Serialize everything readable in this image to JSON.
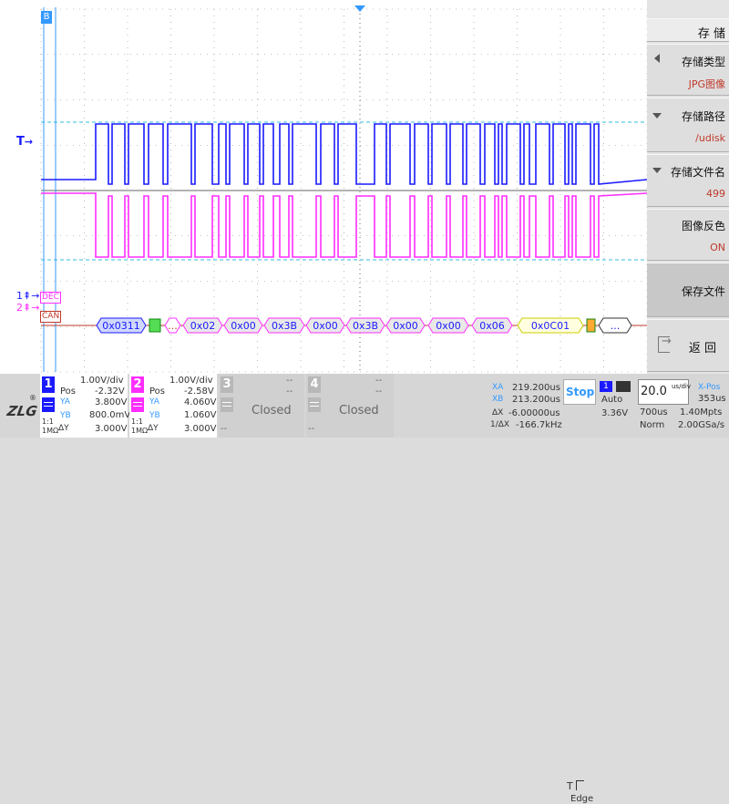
{
  "scope": {
    "trigger_marker": "T",
    "ch1_marker": "1",
    "ch2_marker": "2",
    "dec_label": "DEC",
    "can_label": "CAN",
    "cursor_label": "B",
    "bus_frames": [
      "0x0311",
      "...",
      "0x02",
      "0x00",
      "0x3B",
      "0x00",
      "0x3B",
      "0x00",
      "0x00",
      "0x06",
      "0x0C01",
      "..."
    ],
    "colors": {
      "ch1": "#1a1aff",
      "ch2": "#ff2dff",
      "grid": "#8a8a8a",
      "cursor": "#3399ff",
      "trigger_level": "#33bbdd"
    }
  },
  "menu": {
    "title": "存 储",
    "items": [
      {
        "label": "存储类型",
        "value": "JPG图像",
        "icon": "chevron-left-icon"
      },
      {
        "label": "存储路径",
        "value": "/udisk",
        "icon": "triangle-down-icon"
      },
      {
        "label": "存储文件名",
        "value": "499",
        "icon": "triangle-down-icon"
      },
      {
        "label": "图像反色",
        "value": "ON",
        "icon": ""
      },
      {
        "label": "保存文件",
        "value": "",
        "icon": ""
      },
      {
        "label": "返 回",
        "value": "",
        "icon": "back-icon"
      }
    ]
  },
  "status": {
    "logo": "ZLG",
    "ch1": {
      "num": "1",
      "scale": "1.00V/div",
      "pos_label": "Pos",
      "pos": "-2.32V",
      "ya_label": "YA",
      "ya": "3.800V",
      "yb_label": "YB",
      "yb": "800.0mV",
      "dy_label": "ΔY",
      "dy": "3.000V",
      "coupling": "1:1",
      "impedance": "1MΩ"
    },
    "ch2": {
      "num": "2",
      "scale": "1.00V/div",
      "pos_label": "Pos",
      "pos": "-2.58V",
      "ya_label": "YA",
      "ya": "4.060V",
      "yb_label": "YB",
      "yb": "1.060V",
      "dy_label": "ΔY",
      "dy": "3.000V",
      "coupling": "1:1",
      "impedance": "1MΩ"
    },
    "ch3": {
      "num": "3",
      "closed": "Closed",
      "dash": "--"
    },
    "ch4": {
      "num": "4",
      "closed": "Closed",
      "dash": "--"
    },
    "cursor": {
      "xa_label": "XA",
      "xa": "219.200us",
      "xb_label": "XB",
      "xb": "213.200us",
      "dx_label": "ΔX",
      "dx": "-6.00000us",
      "fx_label": "1/ΔX",
      "fx": "-166.7kHz"
    },
    "trigger": {
      "state": "Stop",
      "mode": "Auto",
      "level": "3.36V",
      "type": "Edge",
      "source": "1",
      "label": "T"
    },
    "timebase": {
      "scale": "20.0",
      "unit": "us/div",
      "xpos_label": "X-Pos",
      "xpos": "353us",
      "delay": "700us",
      "depth": "1.40Mpts",
      "mode": "Norm",
      "rate": "2.00GSa/s"
    }
  }
}
